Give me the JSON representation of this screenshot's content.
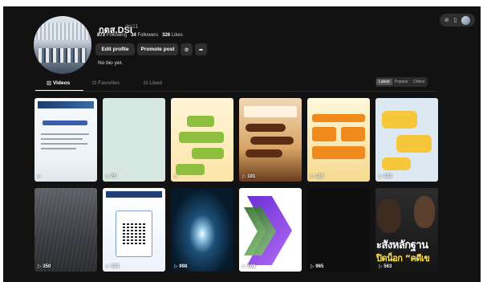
{
  "profile": {
    "username": "กตส.DSI",
    "nickname": "dsi11",
    "following_count": "873",
    "following_label": "Following",
    "followers_count": "34",
    "followers_label": "Followers",
    "likes_count": "326",
    "likes_label": "Likes",
    "edit_label": "Edit profile",
    "promote_label": "Promote post",
    "bio": "No bio yet."
  },
  "tabs": [
    {
      "label": "Videos",
      "icon": "grid-icon"
    },
    {
      "label": "Favorites",
      "icon": "bookmark-icon"
    },
    {
      "label": "Liked",
      "icon": "heart-icon"
    }
  ],
  "sort": [
    "Latest",
    "Popular",
    "Oldest"
  ],
  "videos": [
    {
      "views": ""
    },
    {
      "views": "75"
    },
    {
      "views": ""
    },
    {
      "views": "101"
    },
    {
      "views": "128"
    },
    {
      "views": "143"
    },
    {
      "views": "350"
    },
    {
      "views": "138"
    },
    {
      "views": "998"
    },
    {
      "views": "108"
    },
    {
      "views": "965"
    },
    {
      "views": "563"
    }
  ],
  "overlay_text": {
    "line1": "ะสังหลักฐาน",
    "line2": "ปิดน็อก “คดีเข"
  },
  "colors": {
    "background": "#121212",
    "button": "#2f2f2f",
    "accent_text": "#ffe14d"
  }
}
